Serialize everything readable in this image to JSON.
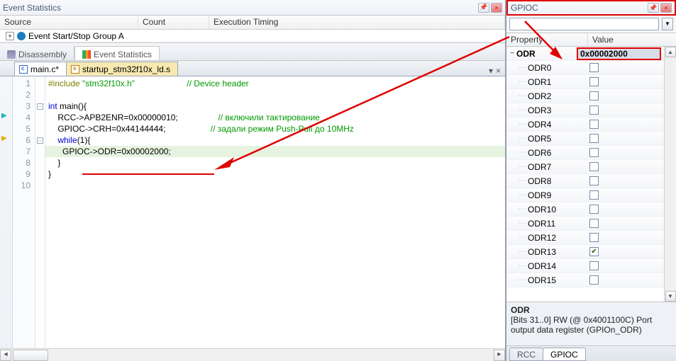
{
  "left": {
    "title": "Event Statistics",
    "columns": [
      "Source",
      "Count",
      "Execution Timing"
    ],
    "source_row_label": "Event Start/Stop Group A",
    "outline_tabs": {
      "disassembly": "Disassembly",
      "event_statistics": "Event Statistics"
    },
    "file_tabs": {
      "active": "main.c*",
      "inactive": "startup_stm32f10x_ld.s"
    }
  },
  "code": {
    "lines": [
      {
        "n": 1,
        "pp": "#include",
        "str": "\"stm32f10x.h\"",
        "cm": "// Device header"
      },
      {
        "n": 2
      },
      {
        "n": 3,
        "kw": "int",
        "rest": " main(){"
      },
      {
        "n": 4,
        "txt": "    RCC->APB2ENR=0x00000010;",
        "cm": "// включили тактирование"
      },
      {
        "n": 5,
        "txt": "    GPIOC->CRH=0x44144444;",
        "cm": "// задали режим Push-Pull до 10MHz"
      },
      {
        "n": 6,
        "kw": "    while",
        "rest": "(1){"
      },
      {
        "n": 7,
        "txt": "      GPIOC->ODR=0x00002000;"
      },
      {
        "n": 8,
        "txt": "    }"
      },
      {
        "n": 9,
        "txt": "}"
      },
      {
        "n": 10
      }
    ]
  },
  "right": {
    "title": "GPIOC",
    "headers": {
      "property": "Property",
      "value": "Value"
    },
    "root": {
      "name": "ODR",
      "value": "0x00002000"
    },
    "bits": [
      {
        "name": "ODR0",
        "checked": false
      },
      {
        "name": "ODR1",
        "checked": false
      },
      {
        "name": "ODR2",
        "checked": false
      },
      {
        "name": "ODR3",
        "checked": false
      },
      {
        "name": "ODR4",
        "checked": false
      },
      {
        "name": "ODR5",
        "checked": false
      },
      {
        "name": "ODR6",
        "checked": false
      },
      {
        "name": "ODR7",
        "checked": false
      },
      {
        "name": "ODR8",
        "checked": false
      },
      {
        "name": "ODR9",
        "checked": false
      },
      {
        "name": "ODR10",
        "checked": false
      },
      {
        "name": "ODR11",
        "checked": false
      },
      {
        "name": "ODR12",
        "checked": false
      },
      {
        "name": "ODR13",
        "checked": true
      },
      {
        "name": "ODR14",
        "checked": false
      },
      {
        "name": "ODR15",
        "checked": false
      }
    ],
    "desc": {
      "title": "ODR",
      "body": "[Bits 31..0] RW (@ 0x4001100C) Port output data register (GPIOn_ODR)"
    },
    "tabs": {
      "rcc": "RCC",
      "gpioc": "GPIOC"
    }
  }
}
